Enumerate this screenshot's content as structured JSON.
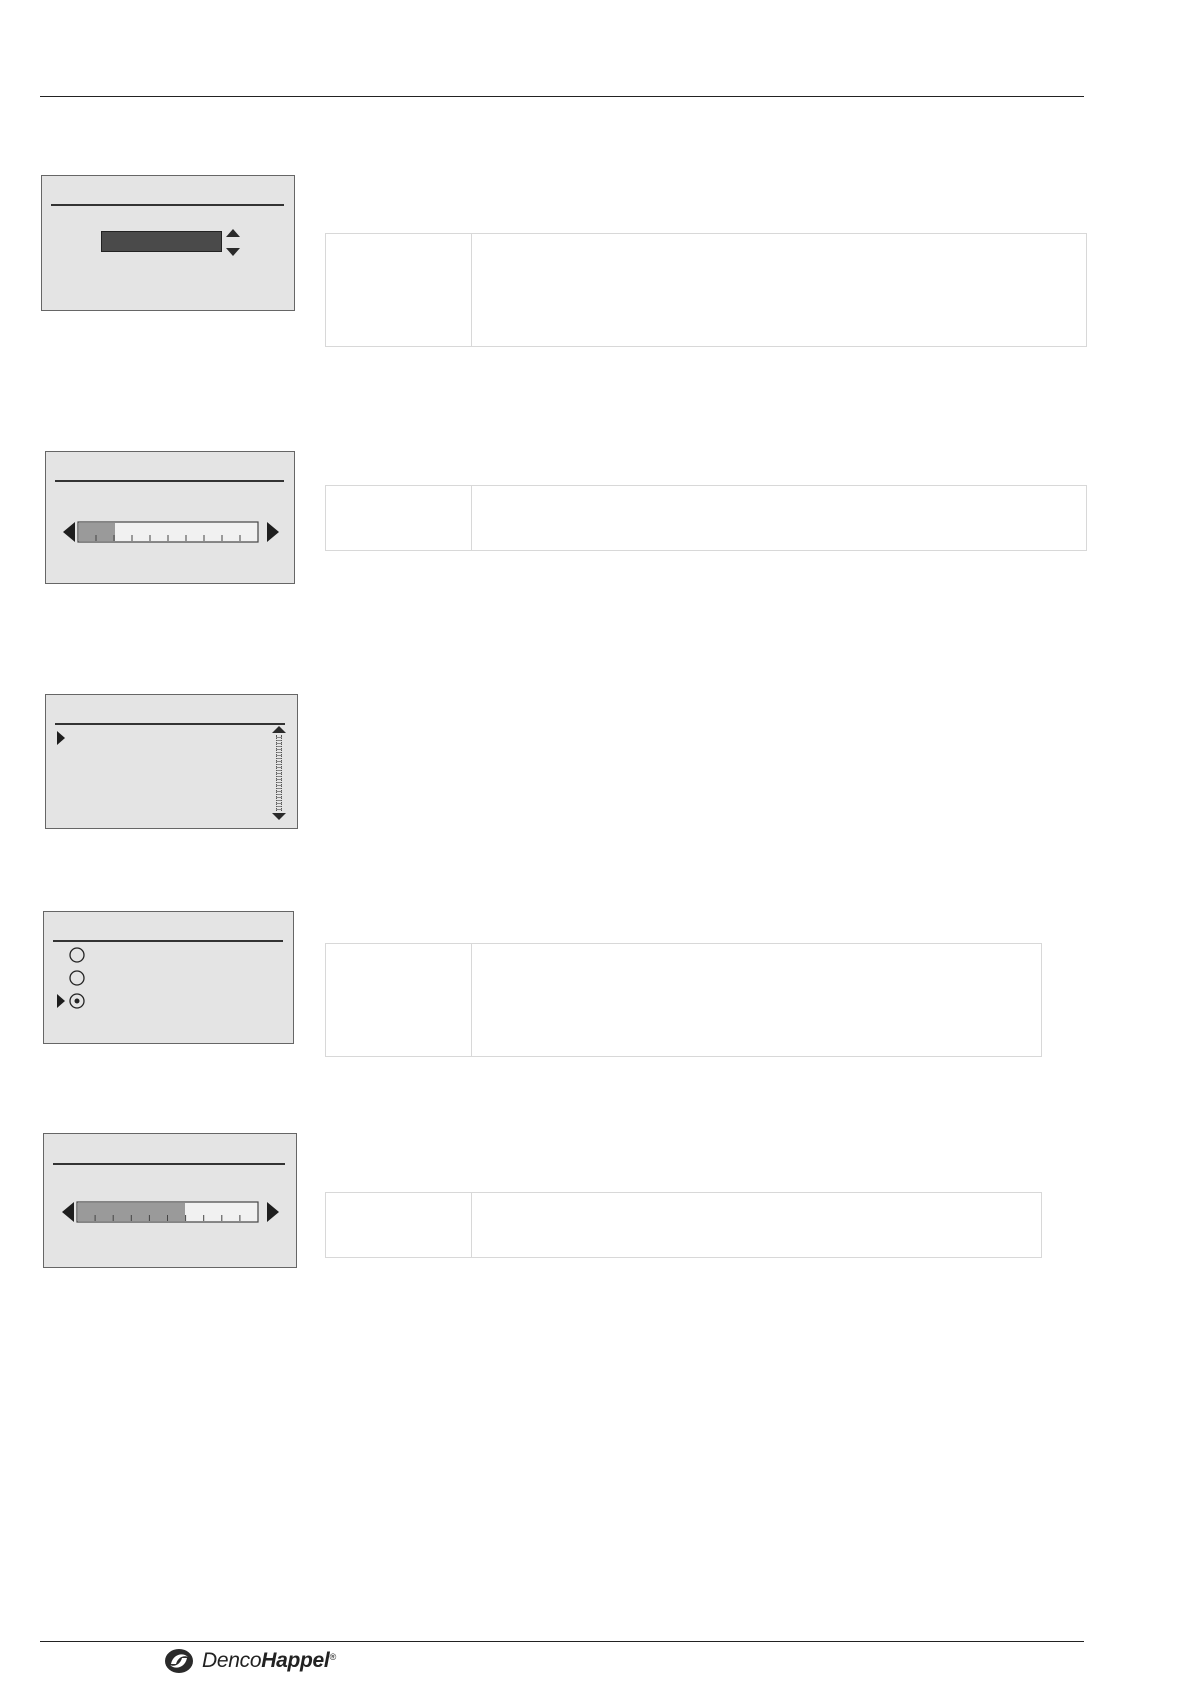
{
  "logo": {
    "word_regular": "Denco",
    "word_bold": "Happel",
    "registered": "®",
    "icon": "dencohappel-logo-icon"
  },
  "widgets": {
    "numeric_editor": {
      "icons": [
        "chevron-up-icon",
        "chevron-down-icon"
      ]
    },
    "slider_low": {
      "fill_fraction": 0.2,
      "ticks": 10,
      "icons": [
        "arrow-left-icon",
        "arrow-right-icon"
      ]
    },
    "list_scroll": {
      "selected_index": 0,
      "icons": [
        "cursor-arrow-icon",
        "scroll-up-icon",
        "scroll-down-icon"
      ]
    },
    "radio_group": {
      "options": 3,
      "selected_index": 2,
      "icons": [
        "cursor-arrow-icon",
        "radio-icon"
      ]
    },
    "slider_high": {
      "fill_fraction": 0.6,
      "ticks": 10,
      "icons": [
        "arrow-left-icon",
        "arrow-right-icon"
      ]
    }
  }
}
